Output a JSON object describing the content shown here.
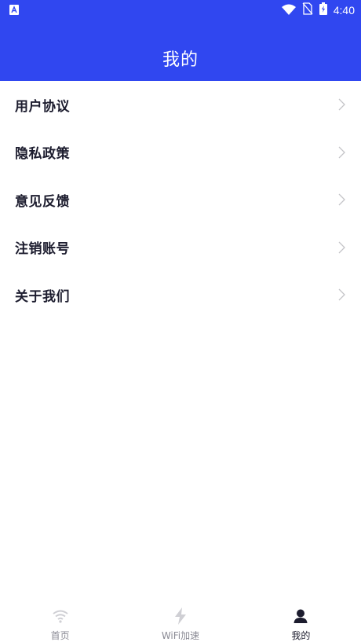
{
  "status_bar": {
    "time": "4:40"
  },
  "header": {
    "title": "我的"
  },
  "menu": {
    "items": [
      {
        "label": "用户协议"
      },
      {
        "label": "隐私政策"
      },
      {
        "label": "意见反馈"
      },
      {
        "label": "注销账号"
      },
      {
        "label": "关于我们"
      }
    ]
  },
  "tabbar": {
    "tabs": [
      {
        "label": "首页",
        "icon": "wifi-icon",
        "active": false
      },
      {
        "label": "WiFi加速",
        "icon": "lightning-icon",
        "active": false
      },
      {
        "label": "我的",
        "icon": "user-icon",
        "active": true
      }
    ]
  },
  "colors": {
    "accent": "#3047f0",
    "text": "#1c1c2e",
    "muted": "#8a8a94"
  }
}
